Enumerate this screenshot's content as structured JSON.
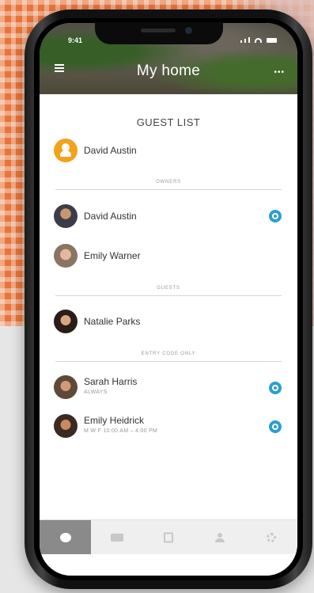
{
  "status_bar": {
    "time": "9:41"
  },
  "header": {
    "title": "My home"
  },
  "guest_list": {
    "title": "GUEST LIST",
    "current_user": "David Austin",
    "sections": {
      "owners": {
        "label": "OWNERS",
        "items": [
          {
            "name": "David Austin",
            "active": true
          },
          {
            "name": "Emily Warner",
            "active": false
          }
        ]
      },
      "guests": {
        "label": "GUESTS",
        "items": [
          {
            "name": "Natalie Parks",
            "active": false
          }
        ]
      },
      "entry_code_only": {
        "label": "ENTRY CODE ONLY",
        "items": [
          {
            "name": "Sarah Harris",
            "schedule": "ALWAYS",
            "active": true
          },
          {
            "name": "Emily Heidrick",
            "schedule": "M W F 10:00 AM – 4:00 PM",
            "active": true
          }
        ]
      }
    }
  },
  "tabs": [
    {
      "icon": "home-dot-icon",
      "active": true
    },
    {
      "icon": "camera-icon",
      "active": false
    },
    {
      "icon": "activity-log-icon",
      "active": false
    },
    {
      "icon": "guests-icon",
      "active": false
    },
    {
      "icon": "settings-icon",
      "active": false
    }
  ],
  "colors": {
    "accent": "#2a9fd1",
    "owner_badge": "#f4a21b",
    "active_tab": "#8a8a8a"
  }
}
